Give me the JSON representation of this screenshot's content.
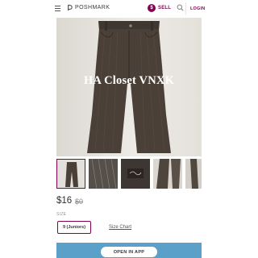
{
  "header": {
    "brand": "POSHMARK",
    "sell_count": "$",
    "sell_label": "SELL",
    "login_label": "LOGIN"
  },
  "listing": {
    "watermark": "HA Closet VNXK",
    "price": "$16",
    "original_price": "$0",
    "size_label": "SIZE",
    "size_value": "9 (Juniors)",
    "size_chart_label": "Size Chart"
  },
  "footer": {
    "open_in_app_label": "OPEN IN APP"
  },
  "colors": {
    "brand": "#7f0353",
    "banner": "#5ba0c8",
    "pants": "#4a4038"
  },
  "icons": [
    "menu-icon",
    "poshmark-logo-icon",
    "sell-badge-icon",
    "search-icon"
  ]
}
